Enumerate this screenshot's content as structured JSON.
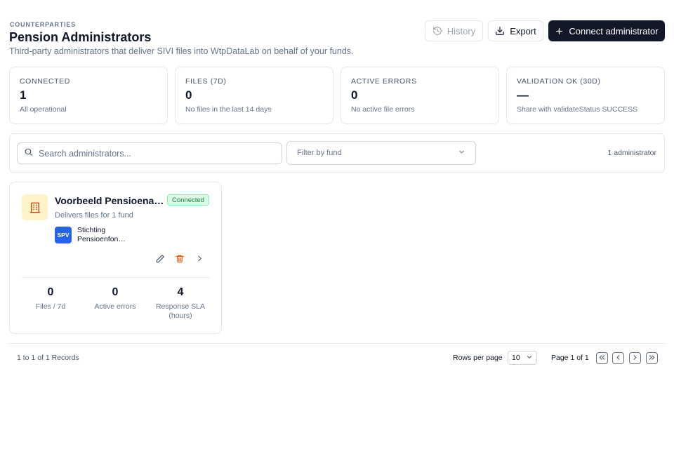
{
  "header": {
    "eyebrow": "COUNTERPARTIES",
    "title": "Pension Administrators",
    "subtitle": "Third-party administrators that deliver SIVI files into WtpDataLab on behalf of your funds.",
    "buttons": {
      "history": "History",
      "export": "Export",
      "connect": "Connect administrator"
    }
  },
  "stats": [
    {
      "label": "CONNECTED",
      "value": "1",
      "sub": "All operational"
    },
    {
      "label": "FILES (7D)",
      "value": "0",
      "sub": "No files in the last 14 days"
    },
    {
      "label": "ACTIVE ERRORS",
      "value": "0",
      "sub": "No active file errors"
    },
    {
      "label": "VALIDATION OK (30D)",
      "value": "—",
      "sub": "Share with validateStatus SUCCESS"
    }
  ],
  "filters": {
    "search_placeholder": "Search administrators...",
    "fund_placeholder": "Filter by fund",
    "count": "1 administrator"
  },
  "administrator": {
    "name": "Voorbeeld Pensioena…",
    "status": "Connected",
    "delivers": "Delivers files for 1 fund",
    "fund_badge": "SPV",
    "fund_name": "Stichting Pensioenfon…",
    "metrics": [
      {
        "value": "0",
        "label": "Files / 7d"
      },
      {
        "value": "0",
        "label": "Active errors"
      },
      {
        "value": "4",
        "label": "Response SLA (hours)"
      }
    ]
  },
  "pagination": {
    "records": "1 to 1 of 1 Records",
    "rows_label": "Rows per page",
    "rows_value": "10",
    "page_info": "Page 1 of 1"
  },
  "colors": {
    "primary": "#111827",
    "success_bg": "#dcfce7",
    "success_text": "#15803d",
    "fund_badge": "#2563eb",
    "icon_bg": "#fef3c7",
    "icon_fg": "#c2410c"
  }
}
